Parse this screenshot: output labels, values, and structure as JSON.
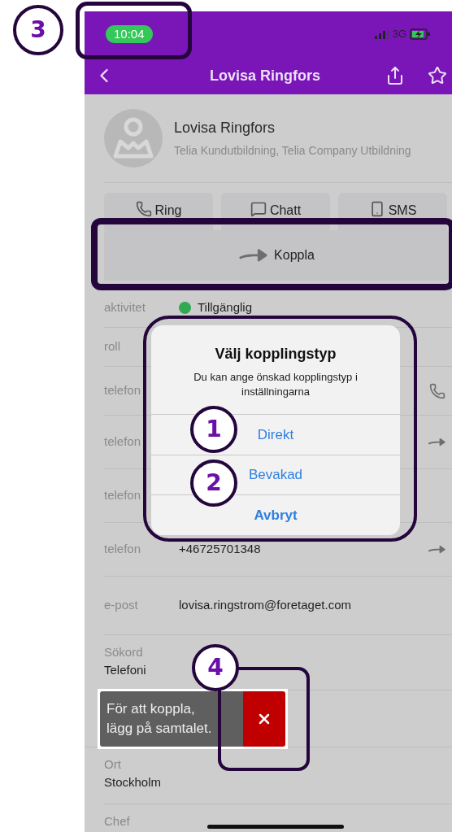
{
  "status_bar": {
    "time": "10:04",
    "network": "3G"
  },
  "header": {
    "title": "Lovisa Ringfors"
  },
  "profile": {
    "name": "Lovisa Ringfors",
    "organization": "Telia Kundutbildning, Telia Company Utbildning"
  },
  "actions": [
    {
      "kind": "phone",
      "label": "Ring"
    },
    {
      "kind": "chat",
      "label": "Chatt"
    },
    {
      "kind": "sms",
      "label": "SMS"
    }
  ],
  "connect_button": {
    "label": "Koppla"
  },
  "fields": [
    {
      "kind": "status",
      "label": "aktivitet",
      "value": "Tillgänglig"
    },
    {
      "kind": "plain",
      "label": "roll"
    },
    {
      "kind": "call",
      "label": "telefon"
    },
    {
      "kind": "forward",
      "label": "telefon"
    },
    {
      "kind": "plain",
      "label": "telefon"
    },
    {
      "kind": "forward",
      "label": "telefon",
      "value": "+46725701348"
    },
    {
      "kind": "plain",
      "label": "e-post",
      "value": "lovisa.ringstrom@foretaget.com"
    },
    {
      "kind": "stacked",
      "label": "Sökord",
      "value": "Telefoni"
    }
  ],
  "toast": {
    "lines": [
      "För att koppla,",
      "lägg på samtalet."
    ]
  },
  "more_fields": [
    {
      "kind": "stacked",
      "label": "Ort",
      "value": "Stockholm"
    },
    {
      "kind": "stacked",
      "label": "Chef"
    }
  ],
  "dialog": {
    "title": "Välj kopplingstyp",
    "message": "Du kan ange önskad kopplingstyp i inställningarna",
    "options": [
      {
        "label": "Direkt",
        "kind": "default"
      },
      {
        "label": "Bevakad",
        "kind": "default"
      },
      {
        "label": "Avbryt",
        "kind": "cancel"
      }
    ]
  },
  "annotations": [
    {
      "label": "1"
    },
    {
      "label": "2"
    },
    {
      "label": "3"
    },
    {
      "label": "4"
    }
  ]
}
